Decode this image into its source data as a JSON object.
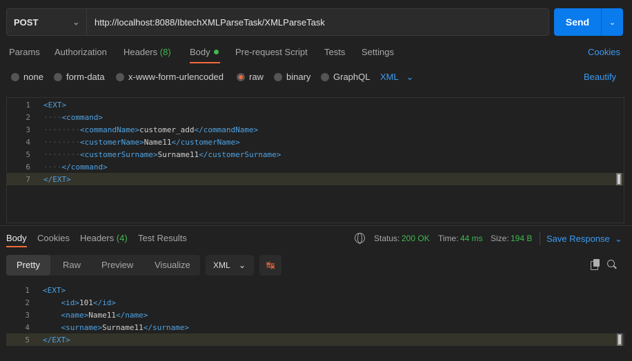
{
  "request": {
    "method": "POST",
    "url": "http://localhost:8088/IbtechXMLParseTask/XMLParseTask",
    "send_label": "Send"
  },
  "req_tabs": {
    "params": "Params",
    "authorization": "Authorization",
    "headers": "Headers",
    "headers_count": "(8)",
    "body": "Body",
    "pre_request": "Pre-request Script",
    "tests": "Tests",
    "settings": "Settings",
    "cookies": "Cookies"
  },
  "body_types": {
    "none": "none",
    "form_data": "form-data",
    "urlencoded": "x-www-form-urlencoded",
    "raw": "raw",
    "binary": "binary",
    "graphql": "GraphQL",
    "language": "XML",
    "selected": "raw",
    "beautify": "Beautify"
  },
  "request_body": [
    {
      "n": "1",
      "indent": "",
      "open": "<EXT>",
      "text": "",
      "close": ""
    },
    {
      "n": "2",
      "indent": "····",
      "open": "<command>",
      "text": "",
      "close": ""
    },
    {
      "n": "3",
      "indent": "········",
      "open": "<commandName>",
      "text": "customer_add",
      "close": "</commandName>"
    },
    {
      "n": "4",
      "indent": "········",
      "open": "<customerName>",
      "text": "Name11",
      "close": "</customerName>"
    },
    {
      "n": "5",
      "indent": "········",
      "open": "<customerSurname>",
      "text": "Surname11",
      "close": "</customerSurname>"
    },
    {
      "n": "6",
      "indent": "····",
      "open": "</command>",
      "text": "",
      "close": ""
    },
    {
      "n": "7",
      "indent": "",
      "open": "</EXT>",
      "text": "",
      "close": ""
    }
  ],
  "resp_tabs": {
    "body": "Body",
    "cookies": "Cookies",
    "headers": "Headers",
    "headers_count": "(4)",
    "test_results": "Test Results"
  },
  "status": {
    "status_label": "Status:",
    "status_value": "200 OK",
    "time_label": "Time:",
    "time_value": "44 ms",
    "size_label": "Size:",
    "size_value": "194 B",
    "save_response": "Save Response"
  },
  "view": {
    "pretty": "Pretty",
    "raw": "Raw",
    "preview": "Preview",
    "visualize": "Visualize",
    "format": "XML"
  },
  "response_body": [
    {
      "n": "1",
      "indent": "",
      "open": "<EXT>",
      "text": "",
      "close": ""
    },
    {
      "n": "2",
      "indent": "    ",
      "open": "<id>",
      "text": "101",
      "close": "</id>"
    },
    {
      "n": "3",
      "indent": "    ",
      "open": "<name>",
      "text": "Name11",
      "close": "</name>"
    },
    {
      "n": "4",
      "indent": "    ",
      "open": "<surname>",
      "text": "Surname11",
      "close": "</surname>"
    },
    {
      "n": "5",
      "indent": "",
      "open": "</EXT>",
      "text": "",
      "close": ""
    }
  ],
  "colors": {
    "accent": "#097bed",
    "active_tab": "#f26b3a",
    "link": "#3b9bf5",
    "ok": "#3fb950",
    "xml_tag": "#4fa3e3"
  },
  "icons": [
    "chevron-down-icon",
    "globe-icon",
    "wrap-lines-icon",
    "copy-icon",
    "search-icon"
  ]
}
